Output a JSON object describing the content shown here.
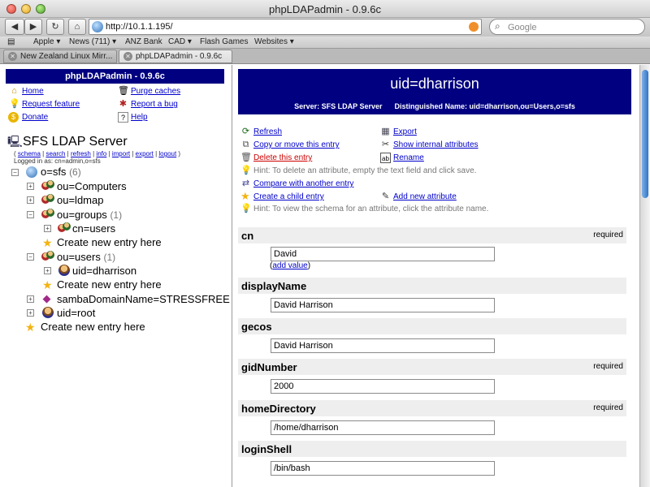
{
  "window": {
    "title": "phpLDAPadmin - 0.9.6c"
  },
  "toolbar": {
    "back_icon": "back-arrow-icon",
    "forward_icon": "forward-arrow-icon",
    "reload_icon": "reload-icon",
    "home_icon": "home-icon",
    "url": "http://10.1.1.195/",
    "search_placeholder": "Google"
  },
  "bookmarks": [
    {
      "label": "Apple ▾"
    },
    {
      "label": "News (711) ▾"
    },
    {
      "label": "ANZ Bank"
    },
    {
      "label": "CAD ▾"
    },
    {
      "label": "Flash Games"
    },
    {
      "label": "Websites ▾"
    }
  ],
  "tabs": [
    {
      "label": "New Zealand Linux Mirr...",
      "active": false
    },
    {
      "label": "phpLDAPadmin - 0.9.6c",
      "active": true
    }
  ],
  "left": {
    "header": "phpLDAPadmin - 0.9.6c",
    "links": {
      "home": "Home",
      "purge": "Purge caches",
      "request": "Request feature",
      "report": "Report a bug",
      "donate": "Donate",
      "help": "Help"
    },
    "server_title": "SFS LDAP Server",
    "server_links": [
      "schema",
      "search",
      "refresh",
      "info",
      "import",
      "export",
      "logout"
    ],
    "logged_in": "Logged in as: cn=admin,o=sfs",
    "tree": {
      "root": {
        "label": "o=sfs",
        "count": "(6)"
      },
      "computers": "ou=Computers",
      "ldmap": "ou=ldmap",
      "groups": {
        "label": "ou=groups",
        "count": "(1)"
      },
      "cn_users": "cn=users",
      "create1": "Create new entry here",
      "users": {
        "label": "ou=users",
        "count": "(1)"
      },
      "uid_dharrison": "uid=dharrison",
      "create2": "Create new entry here",
      "samba": "sambaDomainName=STRESSFREE",
      "uid_root": "uid=root",
      "create3": "Create new entry here"
    }
  },
  "right": {
    "title": "uid=dharrison",
    "server_label": "Server: SFS LDAP Server",
    "dn_label": "Distinguished Name: uid=dharrison,ou=Users,o=sfs",
    "actions": {
      "refresh": "Refresh",
      "export": "Export",
      "copy_move": "Copy or move this entry",
      "internal": "Show internal attributes",
      "delete": "Delete this entry",
      "rename": "Rename",
      "hint1": "Hint: To delete an attribute, empty the text field and click save.",
      "compare": "Compare with another entry",
      "create_child": "Create a child entry",
      "add_attr": "Add new attribute",
      "hint2": "Hint: To view the schema for an attribute, click the attribute name."
    },
    "attributes": [
      {
        "name": "cn",
        "required": "required",
        "value": "David",
        "add_value": "add value"
      },
      {
        "name": "displayName",
        "required": "",
        "value": "David Harrison"
      },
      {
        "name": "gecos",
        "required": "",
        "value": "David Harrison"
      },
      {
        "name": "gidNumber",
        "required": "required",
        "value": "2000"
      },
      {
        "name": "homeDirectory",
        "required": "required",
        "value": "/home/dharrison"
      },
      {
        "name": "loginShell",
        "required": "",
        "value": "/bin/bash"
      }
    ]
  },
  "colors": {
    "navy": "#000080",
    "link": "#0000cc",
    "delete": "#cc0000"
  }
}
